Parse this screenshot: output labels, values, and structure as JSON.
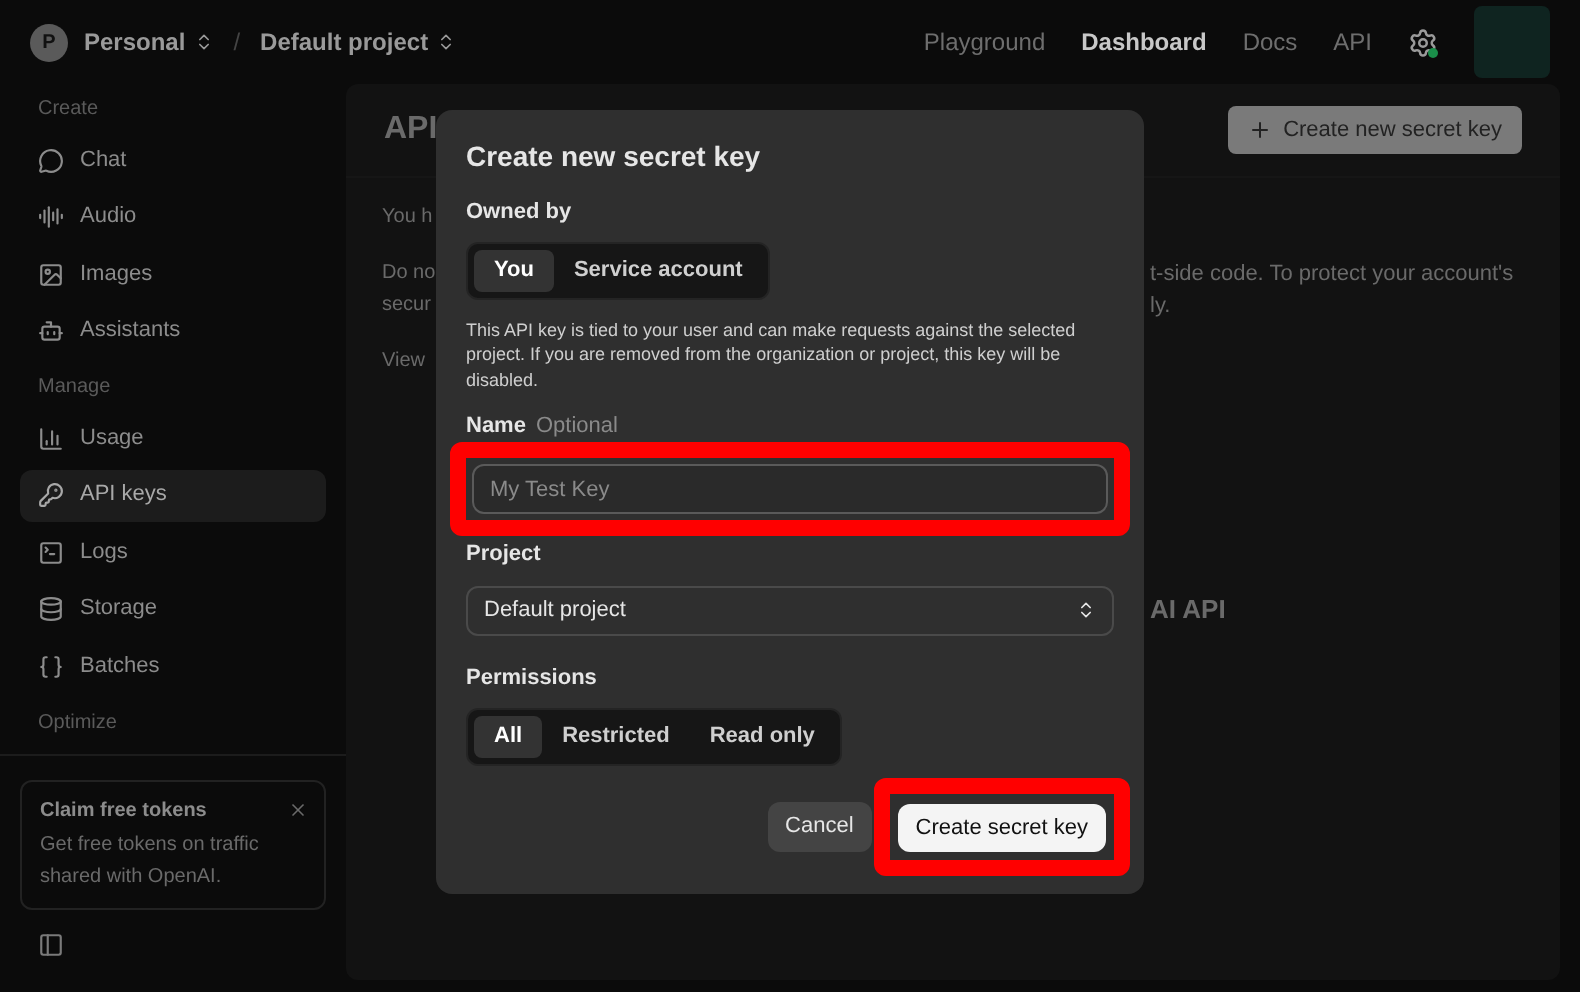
{
  "topbar": {
    "org": {
      "initial": "P",
      "name": "Personal"
    },
    "separator": "/",
    "project": "Default project",
    "nav": [
      {
        "label": "Playground",
        "selected": false
      },
      {
        "label": "Dashboard",
        "selected": true
      },
      {
        "label": "Docs",
        "selected": false
      },
      {
        "label": "API",
        "selected": false
      }
    ]
  },
  "sidebar": {
    "sections": [
      {
        "title": "Create",
        "items": [
          {
            "label": "Chat",
            "kind": "chat",
            "selected": false
          },
          {
            "label": "Audio",
            "kind": "audio",
            "selected": false
          },
          {
            "label": "Images",
            "kind": "images",
            "selected": false
          },
          {
            "label": "Assistants",
            "kind": "assistants",
            "selected": false
          }
        ]
      },
      {
        "title": "Manage",
        "items": [
          {
            "label": "Usage",
            "kind": "usage",
            "selected": false
          },
          {
            "label": "API keys",
            "kind": "keys",
            "selected": true
          },
          {
            "label": "Logs",
            "kind": "logs",
            "selected": false
          },
          {
            "label": "Storage",
            "kind": "storage",
            "selected": false
          },
          {
            "label": "Batches",
            "kind": "batches",
            "selected": false
          }
        ]
      },
      {
        "title": "Optimize"
      }
    ],
    "promo": {
      "title": "Claim free tokens",
      "text": "Get free tokens on traffic shared with OpenAI."
    }
  },
  "page": {
    "title": "API",
    "create_button": "Create new secret key",
    "left_fragments": [
      "You h",
      "Do no",
      "secur",
      "View"
    ],
    "right_fragments": [
      "t-side code. To protect your account's",
      "ly.",
      "AI API"
    ]
  },
  "dialog": {
    "title": "Create new secret key",
    "owned_by": {
      "label": "Owned by",
      "options": [
        {
          "label": "You",
          "selected": true
        },
        {
          "label": "Service account",
          "selected": false
        }
      ]
    },
    "description": "This API key is tied to your user and can make requests against the selected project. If you are removed from the organization or project, this key will be disabled.",
    "name_field": {
      "label": "Name",
      "hint": "Optional",
      "placeholder": "My Test Key",
      "highlighted": true
    },
    "project": {
      "label": "Project",
      "value": "Default project"
    },
    "permissions": {
      "label": "Permissions",
      "options": [
        {
          "label": "All",
          "selected": true
        },
        {
          "label": "Restricted",
          "selected": false
        },
        {
          "label": "Read only",
          "selected": false
        }
      ]
    },
    "cancel": {
      "label": "Cancel"
    },
    "create": {
      "label": "Create secret key",
      "highlighted": true
    }
  }
}
